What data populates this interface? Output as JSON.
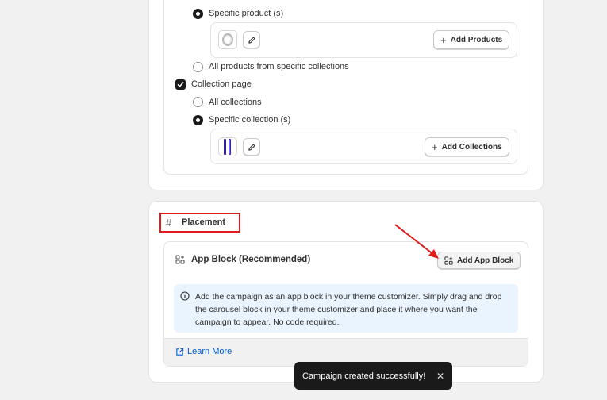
{
  "targeting": {
    "specific_product_label": "Specific product (s)",
    "add_products_label": "Add Products",
    "all_products_collections_label": "All products from specific collections",
    "collection_page_label": "Collection page",
    "all_collections_label": "All collections",
    "specific_collection_label": "Specific collection (s)",
    "add_collections_label": "Add Collections"
  },
  "placement": {
    "title": "Placement",
    "app_block_title": "App Block (Recommended)",
    "add_app_block_label": "Add App Block",
    "info_text": "Add the campaign as an app block in your theme customizer. Simply drag and drop the carousel block in your theme customizer and place it where you want the campaign to appear. No code required.",
    "learn_more_label": "Learn More"
  },
  "toast": {
    "message": "Campaign created successfully!"
  },
  "colors": {
    "accent_link": "#005bd3",
    "highlight": "#e01b1b",
    "info_bg": "#eaf4ff"
  }
}
